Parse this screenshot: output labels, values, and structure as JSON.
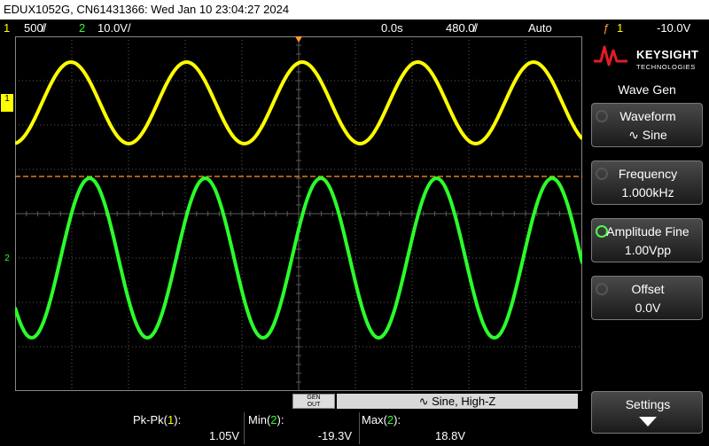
{
  "title_bar": "EDUX1052G, CN61431366: Wed Jan 10 23:04:27 2024",
  "status": {
    "ch1_num": "1",
    "ch1_scale": "500̸/",
    "ch2_num": "2",
    "ch2_scale": "10.0V/",
    "time_pos": "0.0s",
    "time_scale": "480.0̸/",
    "trigger_mode": "Auto",
    "trigger_icon": "ƒ",
    "trigger_channel": "1",
    "trigger_level": "-10.0V"
  },
  "markers": {
    "ch1": "1",
    "ch2": "2"
  },
  "logo": {
    "name": "KEYSIGHT",
    "sub": "TECHNOLOGIES"
  },
  "menu": {
    "title": "Wave Gen",
    "softkeys": [
      {
        "label": "Waveform",
        "value": "∿ Sine",
        "knob_active": false
      },
      {
        "label": "Frequency",
        "value": "1.000kHz",
        "knob_active": false
      },
      {
        "label": "Amplitude Fine",
        "value": "1.00Vpp",
        "knob_active": true
      },
      {
        "label": "Offset",
        "value": "0.0V",
        "knob_active": false
      }
    ],
    "settings_label": "Settings"
  },
  "wavegen_bar": {
    "gen_label": "GEN",
    "out_label": "OUT",
    "status": "∿  Sine, High-Z"
  },
  "measurements": [
    {
      "name": "Pk-Pk",
      "channel": "1",
      "value": "1.05V"
    },
    {
      "name": "Min",
      "channel": "2",
      "value": "-19.3V"
    },
    {
      "name": "Max",
      "channel": "2",
      "value": "18.8V"
    }
  ],
  "colors": {
    "ch1": "#ffff00",
    "ch2": "#2bff2b",
    "trigger": "#ff9a2e",
    "grid": "#5a5a5a"
  }
}
